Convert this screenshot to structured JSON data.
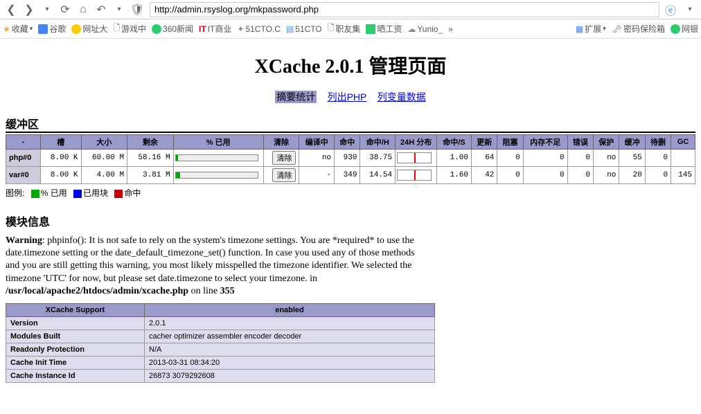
{
  "browser": {
    "url": "http://admin.rsyslog.org/mkpassword.php"
  },
  "bookmarks": {
    "fav": "收藏",
    "items": [
      "谷歌",
      "网址大",
      "游戏中",
      "360新闻",
      "IT商业",
      "51CTO.C",
      "51CTO",
      "职友集",
      "晒工资",
      "Yunio_"
    ],
    "ext": "扩展",
    "pwd": "密码保险箱",
    "bank": "网银"
  },
  "page": {
    "title": "XCache 2.0.1 管理页面",
    "nav": {
      "summary": "摘要统计",
      "listphp": "列出PHP",
      "listvar": "列变量数据"
    },
    "cache_section": "缓冲区",
    "headers": {
      "name": "-",
      "slots": "槽",
      "size": "大小",
      "avail": "剩余",
      "pctused": "% 已用",
      "clear": "清除",
      "compiling": "编译中",
      "hits": "命中",
      "hitsh": "命中/H",
      "dist24h": "24H 分布",
      "hitss": "命中/S",
      "updates": "更新",
      "clogs": "阻塞",
      "ooms": "内存不足",
      "errs": "错误",
      "protect": "保护",
      "cached": "缓冲",
      "deleted": "待删",
      "gc": "GC"
    },
    "rows": [
      {
        "name": "php#0",
        "slots": "8.00 K",
        "size": "60.00 M",
        "avail": "58.16 M",
        "pct": 3,
        "compiling": "no",
        "hits": "930",
        "hitsh": "38.75",
        "dist": 50,
        "hitss": "1.00",
        "updates": "64",
        "clogs": "0",
        "ooms": "0",
        "errs": "0",
        "protect": "no",
        "cached": "55",
        "deleted": "0",
        "gc": ""
      },
      {
        "name": "var#0",
        "slots": "8.00 K",
        "size": "4.00 M",
        "avail": "3.81 M",
        "pct": 5,
        "compiling": "-",
        "hits": "349",
        "hitsh": "14.54",
        "dist": 50,
        "hitss": "1.60",
        "updates": "42",
        "clogs": "0",
        "ooms": "0",
        "errs": "0",
        "protect": "no",
        "cached": "20",
        "deleted": "0",
        "gc": "145"
      }
    ],
    "clear_btn": "清除",
    "legend": {
      "label": "图例:",
      "used": "% 已用",
      "usedblocks": "已用块",
      "hits": "命中"
    },
    "module_section": "模块信息",
    "warning": {
      "prefix": "Warning",
      "body": ": phpinfo(): It is not safe to rely on the system's timezone settings. You are *required* to use the date.timezone setting or the date_default_timezone_set() function. In case you used any of those methods and you are still getting this warning, you most likely misspelled the timezone identifier. We selected the timezone 'UTC' for now, but please set date.timezone to select your timezone. in ",
      "path": "/usr/local/apache2/htdocs/admin/xcache.php",
      "online": " on line ",
      "line": "355"
    },
    "info_headers": {
      "support": "XCache Support",
      "enabled": "enabled"
    },
    "info_rows": [
      {
        "k": "Version",
        "v": "2.0.1"
      },
      {
        "k": "Modules Built",
        "v": "cacher optimizer assembler encoder decoder"
      },
      {
        "k": "Readonly Protection",
        "v": "N/A"
      },
      {
        "k": "Cache Init Time",
        "v": "2013-03-31 08:34:20"
      },
      {
        "k": "Cache Instance Id",
        "v": "26873 3079292608"
      }
    ]
  }
}
